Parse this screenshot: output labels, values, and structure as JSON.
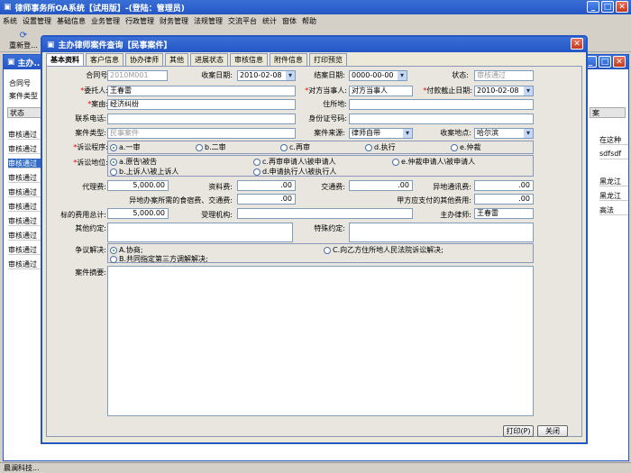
{
  "app": {
    "title": "律师事务所OA系统【试用版】-(登陆：管理员)"
  },
  "menu": [
    "系统",
    "设置管理",
    "基础信息",
    "业务管理",
    "行政管理",
    "财务管理",
    "法规管理",
    "交流平台",
    "统计",
    "窗体",
    "帮助"
  ],
  "toolbar": {
    "refresh": "重新登..."
  },
  "bg": {
    "title": "主办...",
    "fields": [
      "合同号",
      "案件类型"
    ],
    "status_header": "状态",
    "status_rows": [
      "审核通过",
      "审核通过",
      "审核通过",
      "审核通过",
      "审核通过",
      "审核通过",
      "审核通过",
      "审核通过",
      "审核通过",
      "审核通过"
    ],
    "right_header": "案",
    "right_rows": [
      "",
      "在这种",
      "sdfsdf",
      "",
      "黑龙江",
      "黑龙江",
      "高法",
      "",
      "",
      ""
    ],
    "statusbar": "晨澜科技..."
  },
  "dialog": {
    "title": "主办律师案件查询【民事案件】",
    "tabs": [
      "基本资料",
      "客户信息",
      "协办律师",
      "其他",
      "进展状态",
      "审核信息",
      "附件信息",
      "打印预览"
    ],
    "labels": {
      "contract_no": "合同号:",
      "receive_date": "收案日期:",
      "close_date": "结案日期:",
      "status": "状态:",
      "client": "委托人:",
      "opponent": "对方当事人:",
      "pay_deadline": "付款截止日期:",
      "cause": "案由:",
      "address": "住所地:",
      "phone": "联系电话:",
      "id_no": "身份证号码:",
      "case_type": "案件类型:",
      "case_source": "案件来源:",
      "receive_place": "收案地点:",
      "procedure": "诉讼程序:",
      "position": "诉讼地位:",
      "agency_fee": "代理费:",
      "material_fee": "资料费:",
      "traffic_fee": "交通费:",
      "remote_phone_fee": "异地通讯费:",
      "lodging_fee": "异地办案所需的食宿费、交通费:",
      "other_fee_b": "甲方应支付的其他费用:",
      "total_fee": "标的费用总计:",
      "accept_org": "受理机构:",
      "lawyer": "主办律师:",
      "other_agreement": "其他约定:",
      "special_agreement": "特殊约定:",
      "dispute": "争议解决:",
      "summary": "案件摘要:"
    },
    "values": {
      "contract_no": "2010M001",
      "receive_date": "2010-02-08",
      "close_date": "0000-00-00",
      "status": "审核通过",
      "client": "王春雷",
      "opponent": "对方当事人",
      "pay_deadline": "2010-02-08",
      "cause": "经济纠纷",
      "address": "",
      "phone": "",
      "id_no": "",
      "case_type": "民事案件",
      "case_source": "律师自带",
      "receive_place": "哈尔滨",
      "agency_fee": "5,000.00",
      "material_fee": ".00",
      "traffic_fee": ".00",
      "remote_phone_fee": ".00",
      "lodging_fee": ".00",
      "other_fee_b": ".00",
      "total_fee": "5,000.00",
      "accept_org": "",
      "lawyer": "王春雷"
    },
    "procedure_options": [
      "a.一审",
      "b.二审",
      "c.再审",
      "d.执行",
      "e.仲裁"
    ],
    "position_options": [
      "a.原告\\被告",
      "c.再审申请人\\被申请人",
      "e.仲裁申请人\\被申请人",
      "b.上诉人\\被上诉人",
      "d.申请执行人\\被执行人"
    ],
    "dispute_options": [
      "A.协商;",
      "C.向乙方住所地人民法院诉讼解决;",
      "B.共同指定第三方调解解决;"
    ],
    "print_btn": "打印(P)",
    "close_btn": "关闭"
  }
}
